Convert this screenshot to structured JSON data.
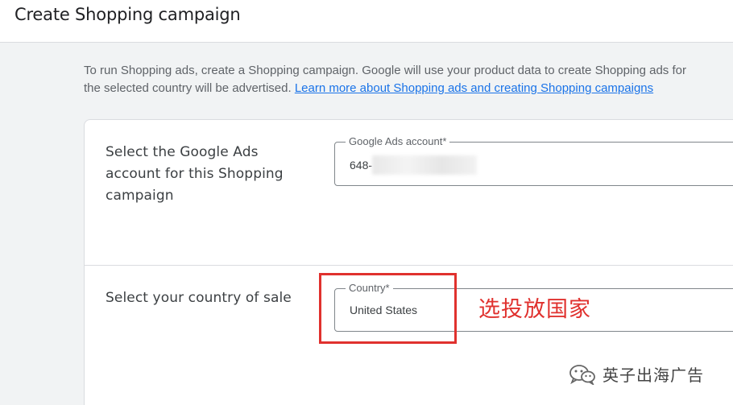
{
  "page": {
    "title": "Create Shopping campaign"
  },
  "intro": {
    "line1": "To run Shopping ads, create a Shopping campaign. Google will use your product data to create Shopping ads for",
    "line2": "the selected country will be advertised.",
    "link": "Learn more about Shopping ads and creating Shopping campaigns"
  },
  "account_section": {
    "label": "Select the Google Ads account for this Shopping campaign",
    "field_label": "Google Ads account*",
    "value": "648-",
    "value_suffix": "(…test)"
  },
  "country_section": {
    "label": "Select your country of sale",
    "field_label": "Country*",
    "value": "United States"
  },
  "annotation": {
    "text": "选投放国家",
    "color": "#e0312e"
  },
  "watermark": {
    "text": "英子出海广告",
    "icon": "wechat-icon"
  },
  "colors": {
    "link": "#1a73e8",
    "background": "#f1f3f4",
    "card": "#ffffff"
  }
}
